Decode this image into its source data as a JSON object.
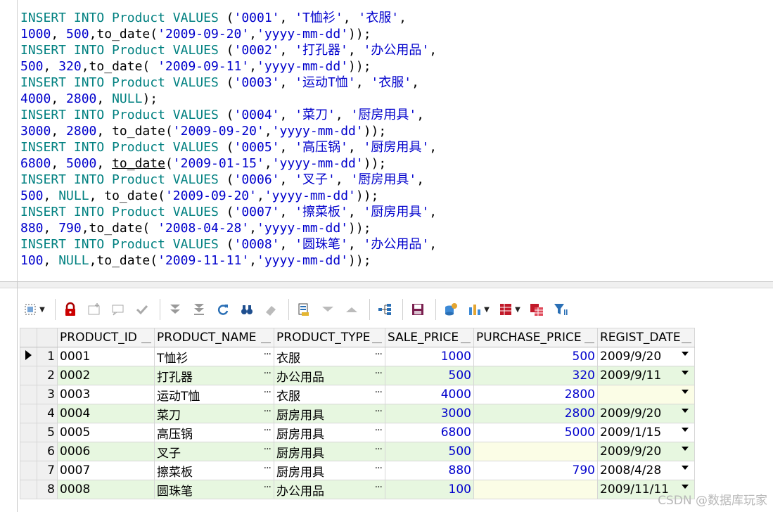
{
  "editor": {
    "lines": [
      [
        {
          "t": "INSERT INTO",
          "c": "kw"
        },
        {
          "t": " Product ",
          "c": "kw"
        },
        {
          "t": "VALUES",
          "c": "kw"
        },
        {
          "t": " (",
          "c": "fn"
        },
        {
          "t": "'0001'",
          "c": "str"
        },
        {
          "t": ", ",
          "c": "fn"
        },
        {
          "t": "'T恤衫'",
          "c": "str"
        },
        {
          "t": ", ",
          "c": "fn"
        },
        {
          "t": "'衣服'",
          "c": "str"
        },
        {
          "t": ",",
          "c": "fn"
        }
      ],
      [
        {
          "t": "1000",
          "c": "num"
        },
        {
          "t": ", ",
          "c": "fn"
        },
        {
          "t": "500",
          "c": "num"
        },
        {
          "t": ",to_date(",
          "c": "fn"
        },
        {
          "t": "'2009-09-20'",
          "c": "str"
        },
        {
          "t": ",",
          "c": "fn"
        },
        {
          "t": "'yyyy-mm-dd'",
          "c": "str"
        },
        {
          "t": "));",
          "c": "fn"
        }
      ],
      [
        {
          "t": "INSERT INTO",
          "c": "kw"
        },
        {
          "t": " Product ",
          "c": "kw"
        },
        {
          "t": "VALUES",
          "c": "kw"
        },
        {
          "t": " (",
          "c": "fn"
        },
        {
          "t": "'0002'",
          "c": "str"
        },
        {
          "t": ", ",
          "c": "fn"
        },
        {
          "t": "'打孔器'",
          "c": "str"
        },
        {
          "t": ", ",
          "c": "fn"
        },
        {
          "t": "'办公用品'",
          "c": "str"
        },
        {
          "t": ",",
          "c": "fn"
        }
      ],
      [
        {
          "t": "500",
          "c": "num"
        },
        {
          "t": ", ",
          "c": "fn"
        },
        {
          "t": "320",
          "c": "num"
        },
        {
          "t": ",to_date( ",
          "c": "fn"
        },
        {
          "t": "'2009-09-11'",
          "c": "str"
        },
        {
          "t": ",",
          "c": "fn"
        },
        {
          "t": "'yyyy-mm-dd'",
          "c": "str"
        },
        {
          "t": "));",
          "c": "fn"
        }
      ],
      [
        {
          "t": "INSERT INTO",
          "c": "kw"
        },
        {
          "t": " Product ",
          "c": "kw"
        },
        {
          "t": "VALUES",
          "c": "kw"
        },
        {
          "t": " (",
          "c": "fn"
        },
        {
          "t": "'0003'",
          "c": "str"
        },
        {
          "t": ", ",
          "c": "fn"
        },
        {
          "t": "'运动T恤'",
          "c": "str"
        },
        {
          "t": ", ",
          "c": "fn"
        },
        {
          "t": "'衣服'",
          "c": "str"
        },
        {
          "t": ",",
          "c": "fn"
        }
      ],
      [
        {
          "t": "4000",
          "c": "num"
        },
        {
          "t": ", ",
          "c": "fn"
        },
        {
          "t": "2800",
          "c": "num"
        },
        {
          "t": ", ",
          "c": "fn"
        },
        {
          "t": "NULL",
          "c": "kw"
        },
        {
          "t": ");",
          "c": "fn"
        }
      ],
      [
        {
          "t": "INSERT INTO",
          "c": "kw"
        },
        {
          "t": " Product ",
          "c": "kw"
        },
        {
          "t": "VALUES",
          "c": "kw"
        },
        {
          "t": " (",
          "c": "fn"
        },
        {
          "t": "'0004'",
          "c": "str"
        },
        {
          "t": ", ",
          "c": "fn"
        },
        {
          "t": "'菜刀'",
          "c": "str"
        },
        {
          "t": ", ",
          "c": "fn"
        },
        {
          "t": "'厨房用具'",
          "c": "str"
        },
        {
          "t": ",",
          "c": "fn"
        }
      ],
      [
        {
          "t": "3000",
          "c": "num"
        },
        {
          "t": ", ",
          "c": "fn"
        },
        {
          "t": "2800",
          "c": "num"
        },
        {
          "t": ", to_date(",
          "c": "fn"
        },
        {
          "t": "'2009-09-20'",
          "c": "str"
        },
        {
          "t": ",",
          "c": "fn"
        },
        {
          "t": "'yyyy-mm-dd'",
          "c": "str"
        },
        {
          "t": "));",
          "c": "fn"
        }
      ],
      [
        {
          "t": "INSERT INTO",
          "c": "kw"
        },
        {
          "t": " Product ",
          "c": "kw"
        },
        {
          "t": "VALUES",
          "c": "kw"
        },
        {
          "t": " (",
          "c": "fn"
        },
        {
          "t": "'0005'",
          "c": "str"
        },
        {
          "t": ", ",
          "c": "fn"
        },
        {
          "t": "'高压锅'",
          "c": "str"
        },
        {
          "t": ", ",
          "c": "fn"
        },
        {
          "t": "'厨房用具'",
          "c": "str"
        },
        {
          "t": ",",
          "c": "fn"
        }
      ],
      [
        {
          "t": "6800",
          "c": "num"
        },
        {
          "t": ", ",
          "c": "fn"
        },
        {
          "t": "5000",
          "c": "num"
        },
        {
          "t": ", ",
          "c": "fn"
        },
        {
          "t": "to_date",
          "c": "fn ul"
        },
        {
          "t": "(",
          "c": "fn"
        },
        {
          "t": "'2009-01-15'",
          "c": "str"
        },
        {
          "t": ",",
          "c": "fn"
        },
        {
          "t": "'yyyy-mm-dd'",
          "c": "str"
        },
        {
          "t": "));",
          "c": "fn"
        }
      ],
      [
        {
          "t": "INSERT INTO",
          "c": "kw"
        },
        {
          "t": " Product ",
          "c": "kw"
        },
        {
          "t": "VALUES",
          "c": "kw"
        },
        {
          "t": " (",
          "c": "fn"
        },
        {
          "t": "'0006'",
          "c": "str"
        },
        {
          "t": ", ",
          "c": "fn"
        },
        {
          "t": "'叉子'",
          "c": "str"
        },
        {
          "t": ", ",
          "c": "fn"
        },
        {
          "t": "'厨房用具'",
          "c": "str"
        },
        {
          "t": ",",
          "c": "fn"
        }
      ],
      [
        {
          "t": "500",
          "c": "num"
        },
        {
          "t": ", ",
          "c": "fn"
        },
        {
          "t": "NULL",
          "c": "kw"
        },
        {
          "t": ", to_date(",
          "c": "fn"
        },
        {
          "t": "'2009-09-20'",
          "c": "str"
        },
        {
          "t": ",",
          "c": "fn"
        },
        {
          "t": "'yyyy-mm-dd'",
          "c": "str"
        },
        {
          "t": "));",
          "c": "fn"
        }
      ],
      [
        {
          "t": "INSERT INTO",
          "c": "kw"
        },
        {
          "t": " Product ",
          "c": "kw"
        },
        {
          "t": "VALUES",
          "c": "kw"
        },
        {
          "t": " (",
          "c": "fn"
        },
        {
          "t": "'0007'",
          "c": "str"
        },
        {
          "t": ", ",
          "c": "fn"
        },
        {
          "t": "'擦菜板'",
          "c": "str"
        },
        {
          "t": ", ",
          "c": "fn"
        },
        {
          "t": "'厨房用具'",
          "c": "str"
        },
        {
          "t": ",",
          "c": "fn"
        }
      ],
      [
        {
          "t": "880",
          "c": "num"
        },
        {
          "t": ", ",
          "c": "fn"
        },
        {
          "t": "790",
          "c": "num"
        },
        {
          "t": ",to_date( ",
          "c": "fn"
        },
        {
          "t": "'2008-04-28'",
          "c": "str"
        },
        {
          "t": ",",
          "c": "fn"
        },
        {
          "t": "'yyyy-mm-dd'",
          "c": "str"
        },
        {
          "t": "));",
          "c": "fn"
        }
      ],
      [
        {
          "t": "INSERT INTO",
          "c": "kw"
        },
        {
          "t": " Product ",
          "c": "kw"
        },
        {
          "t": "VALUES",
          "c": "kw"
        },
        {
          "t": " (",
          "c": "fn"
        },
        {
          "t": "'0008'",
          "c": "str"
        },
        {
          "t": ", ",
          "c": "fn"
        },
        {
          "t": "'圆珠笔'",
          "c": "str"
        },
        {
          "t": ", ",
          "c": "fn"
        },
        {
          "t": "'办公用品'",
          "c": "str"
        },
        {
          "t": ",",
          "c": "fn"
        }
      ],
      [
        {
          "t": "100",
          "c": "num"
        },
        {
          "t": ", ",
          "c": "fn"
        },
        {
          "t": "NULL",
          "c": "kw"
        },
        {
          "t": ",to_date(",
          "c": "fn"
        },
        {
          "t": "'2009-11-11'",
          "c": "str"
        },
        {
          "t": ",",
          "c": "fn"
        },
        {
          "t": "'yyyy-mm-dd'",
          "c": "str"
        },
        {
          "t": "));",
          "c": "fn"
        }
      ]
    ]
  },
  "toolbar": {
    "icons": [
      "select-mode-icon",
      "lock-icon",
      "new-record-icon",
      "comment-icon",
      "check-icon",
      "move-down-icon",
      "move-last-icon",
      "refresh-icon",
      "binoculars-icon",
      "eraser-icon",
      "print-preview-icon",
      "arrow-down-icon",
      "arrow-up-icon",
      "tree-icon",
      "save-icon",
      "database-import-icon",
      "bar-chart-icon",
      "grid-icon",
      "export-icon",
      "filter-icon"
    ]
  },
  "grid": {
    "columns": [
      "PRODUCT_ID",
      "PRODUCT_NAME",
      "PRODUCT_TYPE",
      "SALE_PRICE",
      "PURCHASE_PRICE",
      "REGIST_DATE"
    ],
    "rows": [
      {
        "n": "1",
        "id": "0001",
        "name": "T恤衫",
        "type": "衣服",
        "sale": "1000",
        "purchase": "500",
        "date": "2009/9/20"
      },
      {
        "n": "2",
        "id": "0002",
        "name": "打孔器",
        "type": "办公用品",
        "sale": "500",
        "purchase": "320",
        "date": "2009/9/11"
      },
      {
        "n": "3",
        "id": "0003",
        "name": "运动T恤",
        "type": "衣服",
        "sale": "4000",
        "purchase": "2800",
        "date": ""
      },
      {
        "n": "4",
        "id": "0004",
        "name": "菜刀",
        "type": "厨房用具",
        "sale": "3000",
        "purchase": "2800",
        "date": "2009/9/20"
      },
      {
        "n": "5",
        "id": "0005",
        "name": "高压锅",
        "type": "厨房用具",
        "sale": "6800",
        "purchase": "5000",
        "date": "2009/1/15"
      },
      {
        "n": "6",
        "id": "0006",
        "name": "叉子",
        "type": "厨房用具",
        "sale": "500",
        "purchase": "",
        "date": "2009/9/20"
      },
      {
        "n": "7",
        "id": "0007",
        "name": "擦菜板",
        "type": "厨房用具",
        "sale": "880",
        "purchase": "790",
        "date": "2008/4/28"
      },
      {
        "n": "8",
        "id": "0008",
        "name": "圆珠笔",
        "type": "办公用品",
        "sale": "100",
        "purchase": "",
        "date": "2009/11/11"
      }
    ],
    "ellipsis": "···"
  },
  "watermark": "CSDN @数据库玩家"
}
